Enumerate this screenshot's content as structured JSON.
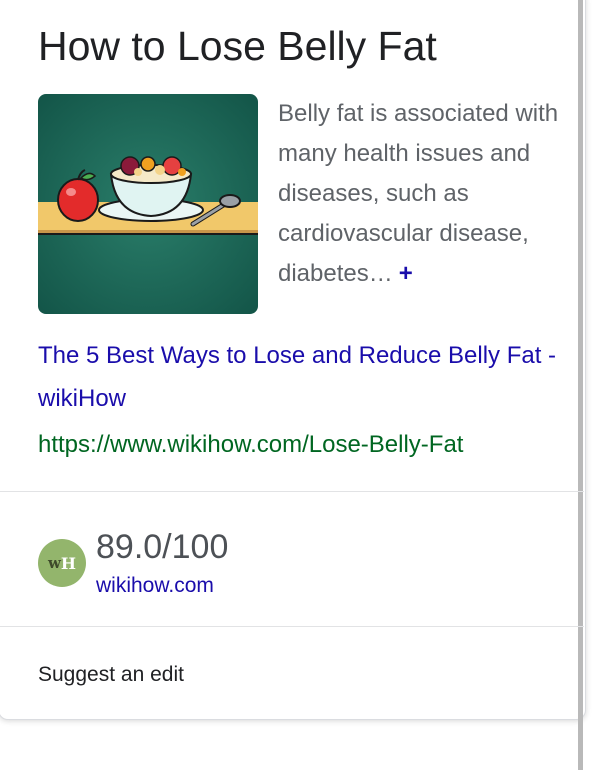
{
  "panel": {
    "title": "How to Lose Belly Fat",
    "description": "Belly fat is associated with many health issues and diseases, such as cardiovascular disease, diabetes…",
    "more_icon": "plus-icon",
    "more_label": "+",
    "image_alt": "Illustration of an apple, a bowl of fruit and a spoon on a table",
    "link_title": "The 5 Best Ways to Lose and Reduce Belly Fat - wikiHow",
    "url": "https://www.wikihow.com/Lose-Belly-Fat"
  },
  "rating": {
    "logo_text_w": "w",
    "logo_text_h": "H",
    "score": "89.0/100",
    "domain": "wikihow.com"
  },
  "footer": {
    "suggest_edit": "Suggest an edit"
  },
  "colors": {
    "link": "#1a0dab",
    "url": "#006621",
    "logo": "#93b56c",
    "chalkboard": "#1d6b5a"
  }
}
